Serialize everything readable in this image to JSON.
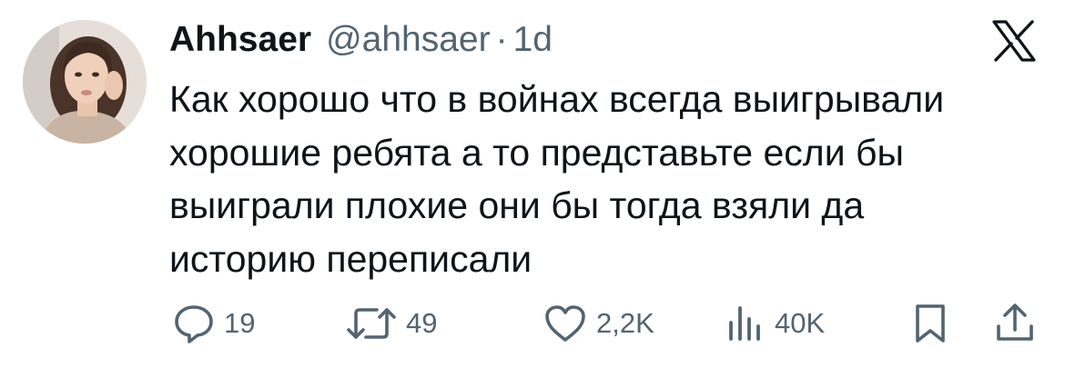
{
  "author": {
    "display_name": "Ahhsaer",
    "handle": "@ahhsaer",
    "separator": "·",
    "time": "1d",
    "avatar_icon": "avatar"
  },
  "tweet": {
    "lines": [
      "Как хорошо что в войнах всегда выигрывали",
      "хорошие ребята а то представьте если бы",
      "выиграли плохие они бы тогда взяли да",
      "историю переписали"
    ]
  },
  "actions": {
    "reply": {
      "icon": "reply-icon",
      "count": "19"
    },
    "retweet": {
      "icon": "retweet-icon",
      "count": "49"
    },
    "like": {
      "icon": "heart-icon",
      "count": "2,2K"
    },
    "views": {
      "icon": "views-icon",
      "count": "40K"
    },
    "bookmark": {
      "icon": "bookmark-icon"
    },
    "share": {
      "icon": "share-icon"
    }
  },
  "brand": {
    "logo": "x-logo",
    "icon_color": "#536471",
    "text_color": "#0f1419"
  }
}
